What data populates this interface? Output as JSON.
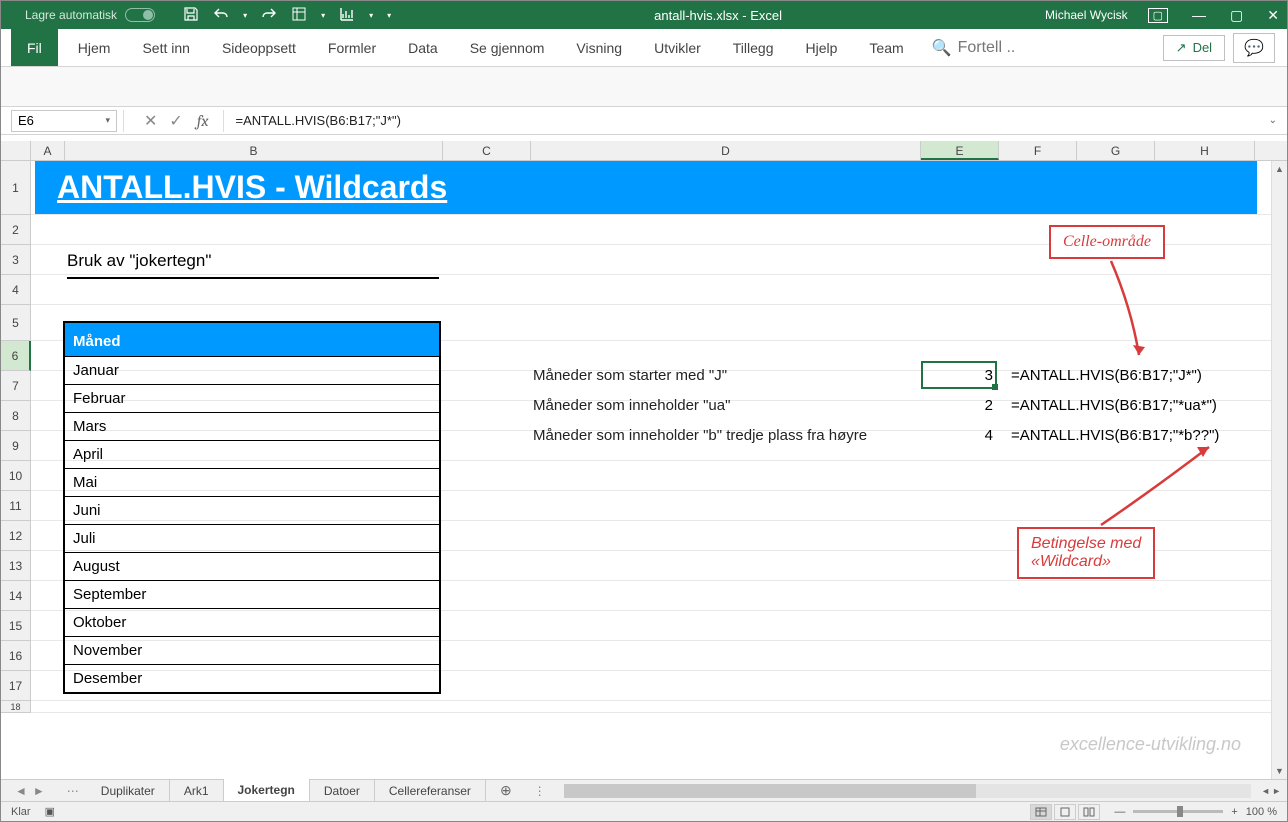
{
  "titlebar": {
    "autosave_label": "Lagre automatisk",
    "filename": "antall-hvis.xlsx  -  Excel",
    "username": "Michael Wycisk"
  },
  "ribbon": {
    "file": "Fil",
    "tabs": [
      "Hjem",
      "Sett inn",
      "Sideoppsett",
      "Formler",
      "Data",
      "Se gjennom",
      "Visning",
      "Utvikler",
      "Tillegg",
      "Hjelp",
      "Team"
    ],
    "search_placeholder": "Fortell ..",
    "share": "Del"
  },
  "formula_bar": {
    "cell_ref": "E6",
    "fx": "fx",
    "formula": "=ANTALL.HVIS(B6:B17;\"J*\")"
  },
  "columns": [
    "A",
    "B",
    "C",
    "D",
    "E",
    "F",
    "G",
    "H"
  ],
  "rows": [
    1,
    2,
    3,
    4,
    5,
    6,
    7,
    8,
    9,
    10,
    11,
    12,
    13,
    14,
    15,
    16,
    17,
    18
  ],
  "sheet": {
    "title_banner": "ANTALL.HVIS - Wildcards",
    "subtitle": "Bruk av \"jokertegn\"",
    "table_header": "Måned",
    "months": [
      "Januar",
      "Februar",
      "Mars",
      "April",
      "Mai",
      "Juni",
      "Juli",
      "August",
      "September",
      "Oktober",
      "November",
      "Desember"
    ],
    "descriptions": [
      "Måneder som starter med \"J\"",
      "Måneder som inneholder \"ua\"",
      "Måneder som inneholder \"b\" tredje plass fra høyre"
    ],
    "results": [
      3,
      2,
      4
    ],
    "formulas": [
      "=ANTALL.HVIS(B6:B17;\"J*\")",
      "=ANTALL.HVIS(B6:B17;\"*ua*\")",
      "=ANTALL.HVIS(B6:B17;\"*b??\")"
    ],
    "callout1": "Celle-område",
    "callout2_l1": "Betingelse med",
    "callout2_l2": "«Wildcard»",
    "watermark": "excellence-utvikling.no"
  },
  "sheet_tabs": [
    "Duplikater",
    "Ark1",
    "Jokertegn",
    "Datoer",
    "Cellereferanser"
  ],
  "active_tab": "Jokertegn",
  "status": {
    "ready": "Klar",
    "zoom": "100 %"
  }
}
